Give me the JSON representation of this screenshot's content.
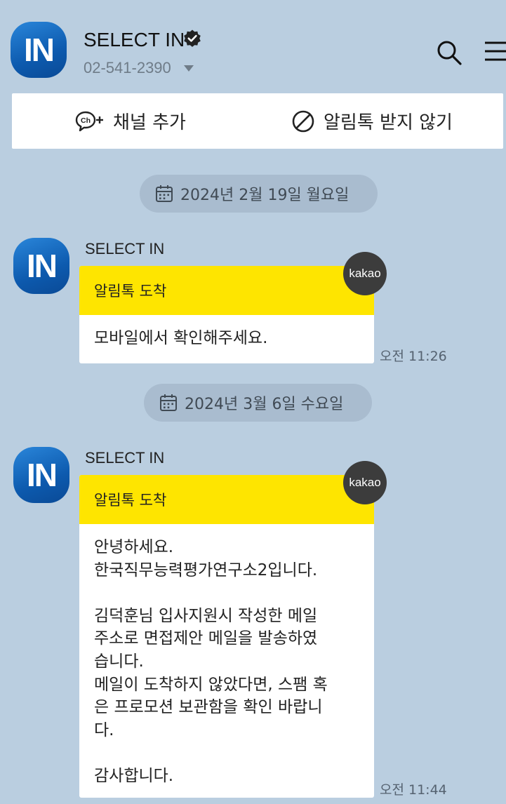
{
  "header": {
    "avatar_text": "IN",
    "channel_name": "SELECT IN",
    "phone": "02-541-2390",
    "icons": [
      "verified-badge-icon",
      "chevron-down-icon",
      "search-icon",
      "menu-icon"
    ]
  },
  "actions": {
    "add_channel_label": "채널 추가",
    "block_label": "알림톡 받지 않기",
    "icons": [
      "channel-add-icon",
      "block-icon"
    ]
  },
  "messages": [
    {
      "date": "2024년 2월 19일 월요일",
      "sender": "SELECT IN",
      "avatar_text": "IN",
      "header": "알림톡 도착",
      "badge": "kakao",
      "body": "모바일에서 확인해주세요.",
      "time": "오전 11:26"
    },
    {
      "date": "2024년 3월 6일 수요일",
      "sender": "SELECT IN",
      "avatar_text": "IN",
      "header": "알림톡 도착",
      "badge": "kakao",
      "body": "안녕하세요.\n한국직무능력평가연구소2입니다.\n\n김덕훈님 입사지원시 작성한 메일\n주소로 면접제안 메일을 발송하였\n습니다.\n메일이 도착하지 않았다면, 스팸 혹\n은 프로모션 보관함을 확인 바랍니\n다.\n\n감사합니다.",
      "time": "오전 11:44"
    }
  ],
  "colors": {
    "background": "#bacee0",
    "alimtalk_yellow": "#fee500",
    "badge": "#3c3c3c",
    "date_pill": "#a9bccf",
    "brand_blue": "#0d5aae"
  }
}
